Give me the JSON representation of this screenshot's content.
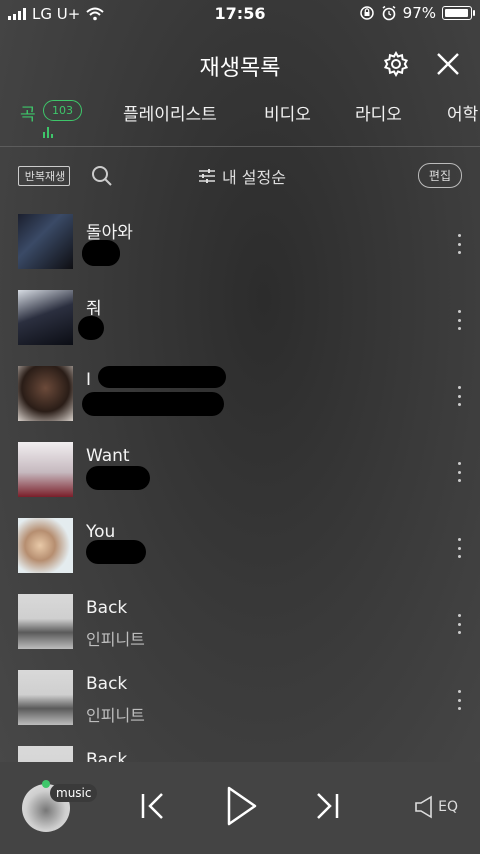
{
  "status_bar": {
    "carrier": "LG U+",
    "time": "17:56",
    "battery": "97%",
    "battery_level": 0.97
  },
  "header": {
    "title": "재생목록"
  },
  "tabs": [
    {
      "label": "곡",
      "badge": "103",
      "active": true
    },
    {
      "label": "플레이리스트"
    },
    {
      "label": "비디오"
    },
    {
      "label": "라디오"
    },
    {
      "label": "어학"
    }
  ],
  "toolbar": {
    "repeat_label": "반복재생",
    "sort_label": "내 설정순",
    "edit_label": "편집"
  },
  "songs": [
    {
      "title": "돌아와",
      "artist": ""
    },
    {
      "title": "줘",
      "artist": ""
    },
    {
      "title": "I",
      "artist": ""
    },
    {
      "title": "Want",
      "artist": ""
    },
    {
      "title": "You",
      "artist": ""
    },
    {
      "title": "Back",
      "artist": "인피니트"
    },
    {
      "title": "Back",
      "artist": "인피니트"
    },
    {
      "title": "Back",
      "artist": ""
    }
  ],
  "player": {
    "badge": "music",
    "eq_label": "EQ"
  },
  "colors": {
    "accent": "#3ec66a"
  }
}
